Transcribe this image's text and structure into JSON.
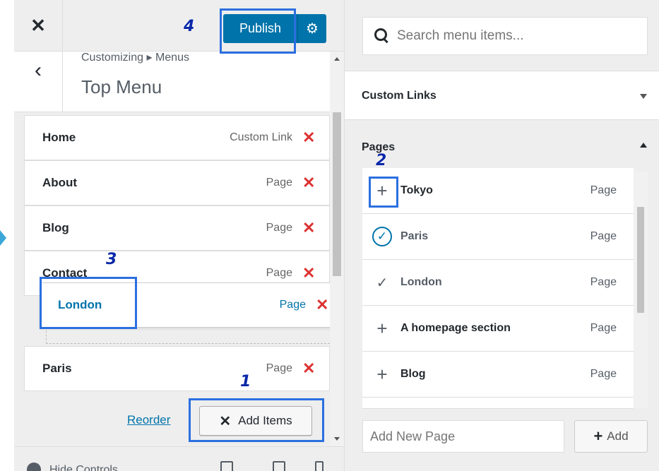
{
  "left": {
    "close_icon": "close-icon",
    "publish_label": "Publish",
    "gear_icon": "gear-icon",
    "breadcrumb": "Customizing ▸ Menus",
    "section_title": "Top Menu",
    "menu_items": [
      {
        "title": "Home",
        "type": "Custom Link"
      },
      {
        "title": "About",
        "type": "Page"
      },
      {
        "title": "Blog",
        "type": "Page"
      },
      {
        "title": "Contact",
        "type": "Page"
      },
      {
        "title": "Paris",
        "type": "Page"
      }
    ],
    "dragging_item": {
      "title": "London",
      "type": "Page"
    },
    "reorder_label": "Reorder",
    "add_items_label": "Add Items",
    "hide_controls_label": "Hide Controls"
  },
  "right": {
    "search_placeholder": "Search menu items...",
    "custom_links_label": "Custom Links",
    "pages_label": "Pages",
    "pages": [
      {
        "title": "Tokyo",
        "type": "Page",
        "state": "add"
      },
      {
        "title": "Paris",
        "type": "Page",
        "state": "added-check-circle"
      },
      {
        "title": "London",
        "type": "Page",
        "state": "added-check"
      },
      {
        "title": "A homepage section",
        "type": "Page",
        "state": "add"
      },
      {
        "title": "Blog",
        "type": "Page",
        "state": "add"
      }
    ],
    "add_new_page_placeholder": "Add New Page",
    "add_label": "Add"
  },
  "annotations": {
    "step1": "1",
    "step2": "2",
    "step3": "3",
    "step4": "4",
    "highlight_color": "#2b6fe0"
  },
  "colors": {
    "accent": "#0073aa",
    "remove": "#dc3232"
  }
}
